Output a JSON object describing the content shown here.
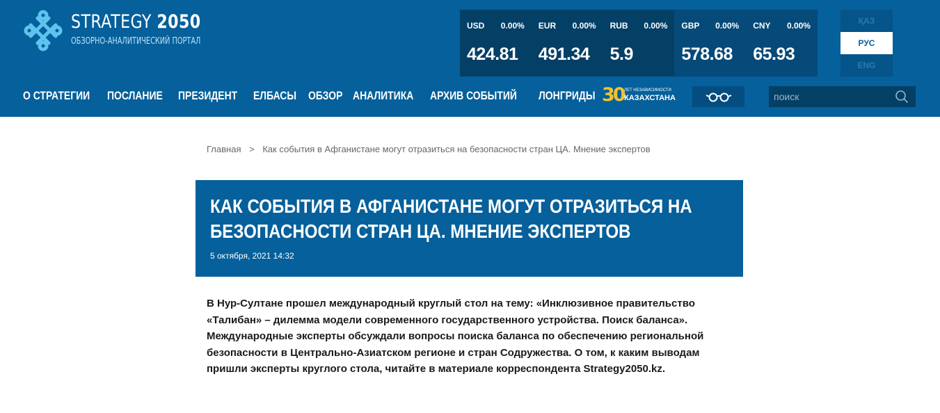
{
  "logo": {
    "title_light": "STRATEGY ",
    "title_bold": "2050",
    "subtitle": "ОБЗОРНО-АНАЛИТИЧЕСКИЙ ПОРТАЛ"
  },
  "rates": [
    {
      "code": "USD",
      "change": "0.00%",
      "value": "424.81"
    },
    {
      "code": "EUR",
      "change": "0.00%",
      "value": "491.34"
    },
    {
      "code": "RUB",
      "change": "0.00%",
      "value": "5.9"
    },
    {
      "code": "GBP",
      "change": "0.00%",
      "value": "578.68"
    },
    {
      "code": "CNY",
      "change": "0.00%",
      "value": "65.93"
    }
  ],
  "languages": [
    {
      "label": "ҚАЗ",
      "active": false
    },
    {
      "label": "РУС",
      "active": true
    },
    {
      "label": "ENG",
      "active": false
    }
  ],
  "nav": [
    "О СТРАТЕГИИ",
    "ПОСЛАНИЕ",
    "ПРЕЗИДЕНТ",
    "ЕЛБАСЫ",
    "ОБЗОР",
    "АНАЛИТИКА",
    "АРХИВ СОБЫТИЙ",
    "ЛОНГРИДЫ"
  ],
  "anniversary": {
    "number": "30",
    "small": "ЛЕТ НЕЗАВИСИМОСТИ",
    "big": "КАЗАХСТАНА"
  },
  "search": {
    "placeholder": "поиск"
  },
  "breadcrumb": {
    "home": "Главная",
    "separator": ">",
    "current": "Как события в Афганистане могут отразиться на безопасности стран ЦА. Мнение экспертов"
  },
  "article": {
    "title": "КАК СОБЫТИЯ В АФГАНИСТАНЕ МОГУТ ОТРАЗИТЬСЯ НА БЕЗОПАСНОСТИ СТРАН ЦА. МНЕНИЕ ЭКСПЕРТОВ",
    "date": "5 октября, 2021 14:32",
    "lead": "В Нур-Султане прошел международный круглый стол на тему: «Инклюзивное правительство «Талибан» – дилемма модели современного государственного устройства. Поиск баланса». Международные эксперты обсуждали вопросы поиска баланса по обеспечению региональной безопасности в Центрально-Азиатском регионе и стран Содружества. О том, к каким выводам пришли эксперты круглого стола, читайте в материале корреспондента Strategy2050.kz."
  },
  "colors": {
    "header_bg": "#05609b",
    "rate_bg": "#043f66",
    "anniversary_accent": "#f2c230"
  },
  "icons": [
    "logo-knot-icon",
    "glasses-icon",
    "search-icon"
  ]
}
